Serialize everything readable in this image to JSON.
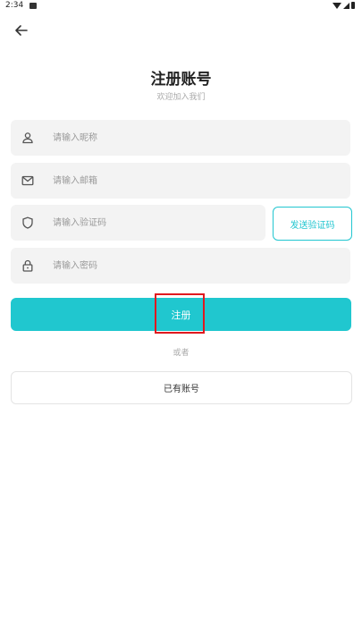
{
  "status_bar": {
    "time": "2:34"
  },
  "header": {
    "title": "注册账号",
    "subtitle": "欢迎加入我们"
  },
  "form": {
    "nickname_placeholder": "请输入昵称",
    "email_placeholder": "请输入邮箱",
    "code_placeholder": "请输入验证码",
    "password_placeholder": "请输入密码",
    "send_code_label": "发送验证码",
    "register_label": "注册",
    "or_label": "或者",
    "have_account_label": "已有账号"
  },
  "colors": {
    "accent": "#20c7cf",
    "highlight": "#e0191f"
  },
  "icons": [
    "back-arrow-icon",
    "user-icon",
    "mail-icon",
    "shield-icon",
    "lock-icon"
  ]
}
